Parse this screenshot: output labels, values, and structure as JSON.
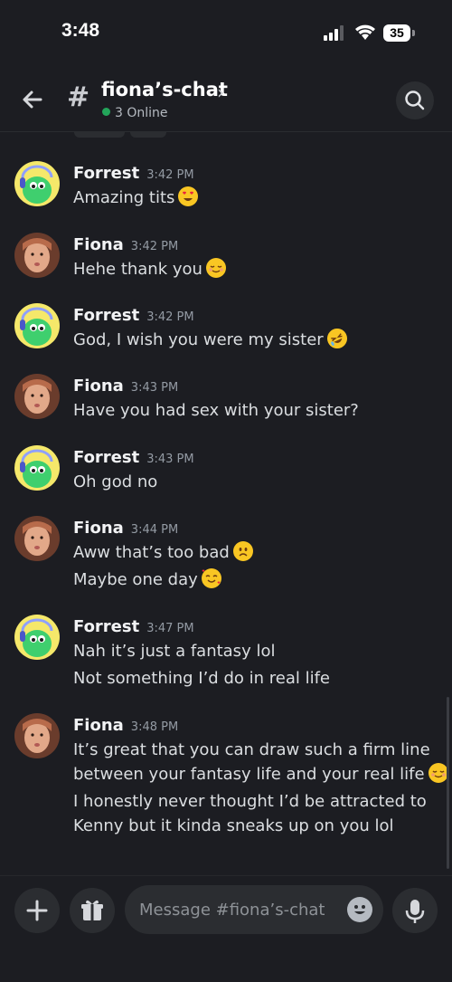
{
  "status_bar": {
    "time": "3:48",
    "battery": "35"
  },
  "header": {
    "hash": "#",
    "channel_name": "fiona’s-chat",
    "chevron": "›",
    "online_text": "3 Online"
  },
  "messages": [
    {
      "author": "Forrest",
      "time": "3:42 PM",
      "lines": [
        "Amazing tits"
      ],
      "emoji": [
        "heart-eyes"
      ]
    },
    {
      "author": "Fiona",
      "time": "3:42 PM",
      "lines": [
        "Hehe thank you"
      ],
      "emoji": [
        "relieved"
      ]
    },
    {
      "author": "Forrest",
      "time": "3:42 PM",
      "lines": [
        "God, I wish you were my sister"
      ],
      "emoji": [
        "rofl"
      ]
    },
    {
      "author": "Fiona",
      "time": "3:43 PM",
      "lines": [
        "Have you had sex with your sister?"
      ]
    },
    {
      "author": "Forrest",
      "time": "3:43 PM",
      "lines": [
        "Oh god no"
      ]
    },
    {
      "author": "Fiona",
      "time": "3:44 PM",
      "lines": [
        "Aww that’s too bad",
        "Maybe one day"
      ],
      "emoji": [
        "slightly-frowning",
        "smiling-with-hearts"
      ]
    },
    {
      "author": "Forrest",
      "time": "3:47 PM",
      "lines": [
        "Nah it’s just a fantasy lol",
        "Not something I’d do in real life"
      ]
    },
    {
      "author": "Fiona",
      "time": "3:48 PM",
      "lines": [
        "It’s great that you can draw such a firm line",
        "between your fantasy life and your real life",
        "I honestly never thought I’d be attracted to",
        "Kenny but it kinda sneaks up on you lol"
      ],
      "emoji": [
        "relieved"
      ]
    }
  ],
  "composer": {
    "placeholder": "Message #fiona’s-chat"
  },
  "icons": {
    "back": "arrow-left-icon",
    "search": "search-icon",
    "add": "plus-icon",
    "gift": "gift-icon",
    "emoji": "emoji-icon",
    "mic": "microphone-icon"
  },
  "colors": {
    "background": "#1c1d22",
    "surface": "#2b2d31",
    "online": "#23a55a",
    "timestamp": "#949ba4"
  }
}
